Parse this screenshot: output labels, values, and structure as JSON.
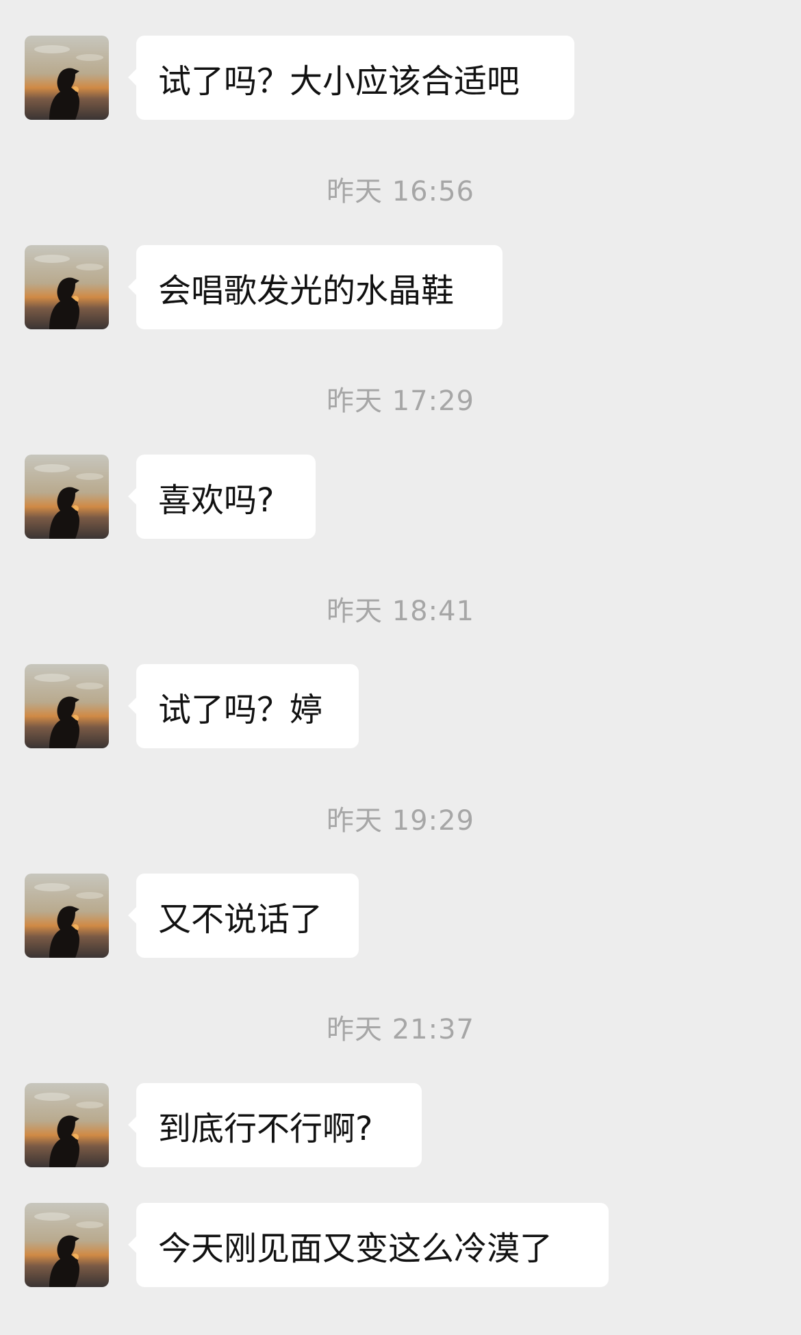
{
  "conversation": [
    {
      "type": "message",
      "text": "试了吗？大小应该合适吧"
    },
    {
      "type": "time",
      "text": "昨天 16:56"
    },
    {
      "type": "message",
      "text": "会唱歌发光的水晶鞋"
    },
    {
      "type": "time",
      "text": "昨天 17:29"
    },
    {
      "type": "message",
      "text": "喜欢吗?"
    },
    {
      "type": "time",
      "text": "昨天 18:41"
    },
    {
      "type": "message",
      "text": "试了吗？婷"
    },
    {
      "type": "time",
      "text": "昨天 19:29"
    },
    {
      "type": "message",
      "text": "又不说话了"
    },
    {
      "type": "time",
      "text": "昨天 21:37"
    },
    {
      "type": "message",
      "text": "到底行不行啊?"
    },
    {
      "type": "message",
      "text": "今天刚见面又变这么冷漠了"
    }
  ],
  "colors": {
    "background": "#ededed",
    "bubble": "#ffffff",
    "timestamp_text": "#a6a6a6",
    "message_text": "#111111"
  },
  "icons": {
    "avatar": "silhouette-sunset-avatar"
  }
}
